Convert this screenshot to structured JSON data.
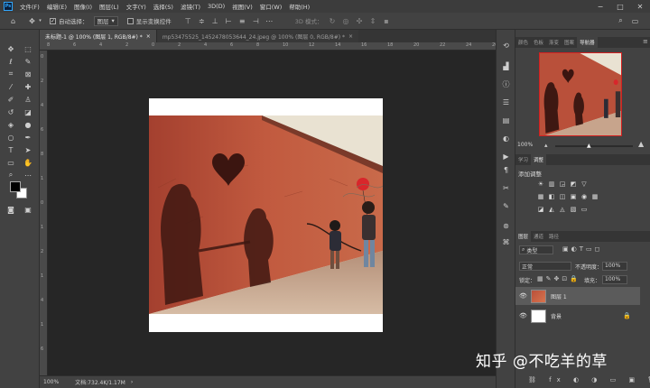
{
  "menubar": {
    "logo": "Ps",
    "items": [
      "文件(F)",
      "编辑(E)",
      "图像(I)",
      "图层(L)",
      "文字(Y)",
      "选择(S)",
      "滤镜(T)",
      "3D(D)",
      "视图(V)",
      "窗口(W)",
      "帮助(H)"
    ],
    "window_controls": [
      "−",
      "□",
      "✕"
    ]
  },
  "options": {
    "auto_select_label": "自动选择：",
    "auto_select_value": "图层",
    "show_transform_label": "显示变换控件",
    "mode_label": "3D 模式："
  },
  "tabs": [
    {
      "label": "未标题-1 @ 100% (图层 1, RGB/8#) *",
      "close": "×",
      "active": true
    },
    {
      "label": "mp53475525_1452478053644_24.jpeg @ 100% (图层 0, RGB/8#) *",
      "close": "×",
      "active": false
    }
  ],
  "ruler_top_labels": [
    "8",
    "6",
    "4",
    "2",
    "0",
    "2",
    "4",
    "6",
    "8",
    "10",
    "12",
    "14",
    "16",
    "18",
    "20",
    "22",
    "24",
    "26"
  ],
  "ruler_left_labels": [
    "0",
    "2",
    "4",
    "6",
    "8",
    "1",
    "0",
    "1",
    "2",
    "1",
    "4",
    "1",
    "6"
  ],
  "status": {
    "zoom": "100%",
    "doc_info": "文档:732.4K/1.17M",
    "arrow": "›"
  },
  "panels": {
    "navigator_tabs": [
      "颜色",
      "色板",
      "渐变",
      "图案",
      "导航器"
    ],
    "navigator_active": "导航器",
    "nav_zoom": "100%",
    "adjust_tabs": [
      "学习",
      "调整"
    ],
    "adjust_active": "调整",
    "adjust_title": "添加调整",
    "layers_tabs": [
      "图层",
      "通道",
      "路径"
    ],
    "layers_active": "图层",
    "filter_type": "类型",
    "blend_mode": "正常",
    "opacity_label": "不透明度：",
    "opacity_value": "100%",
    "lock_label": "锁定：",
    "fill_label": "填充：",
    "fill_value": "100%",
    "layers": [
      {
        "name": "图层 1",
        "selected": true
      },
      {
        "name": "背景",
        "selected": false
      }
    ]
  },
  "watermark": "知乎 @不吃羊的草",
  "colors": {
    "accent": "#31a8ff",
    "wall": "#b9503a",
    "selected_layer": "#5b5b5b"
  }
}
